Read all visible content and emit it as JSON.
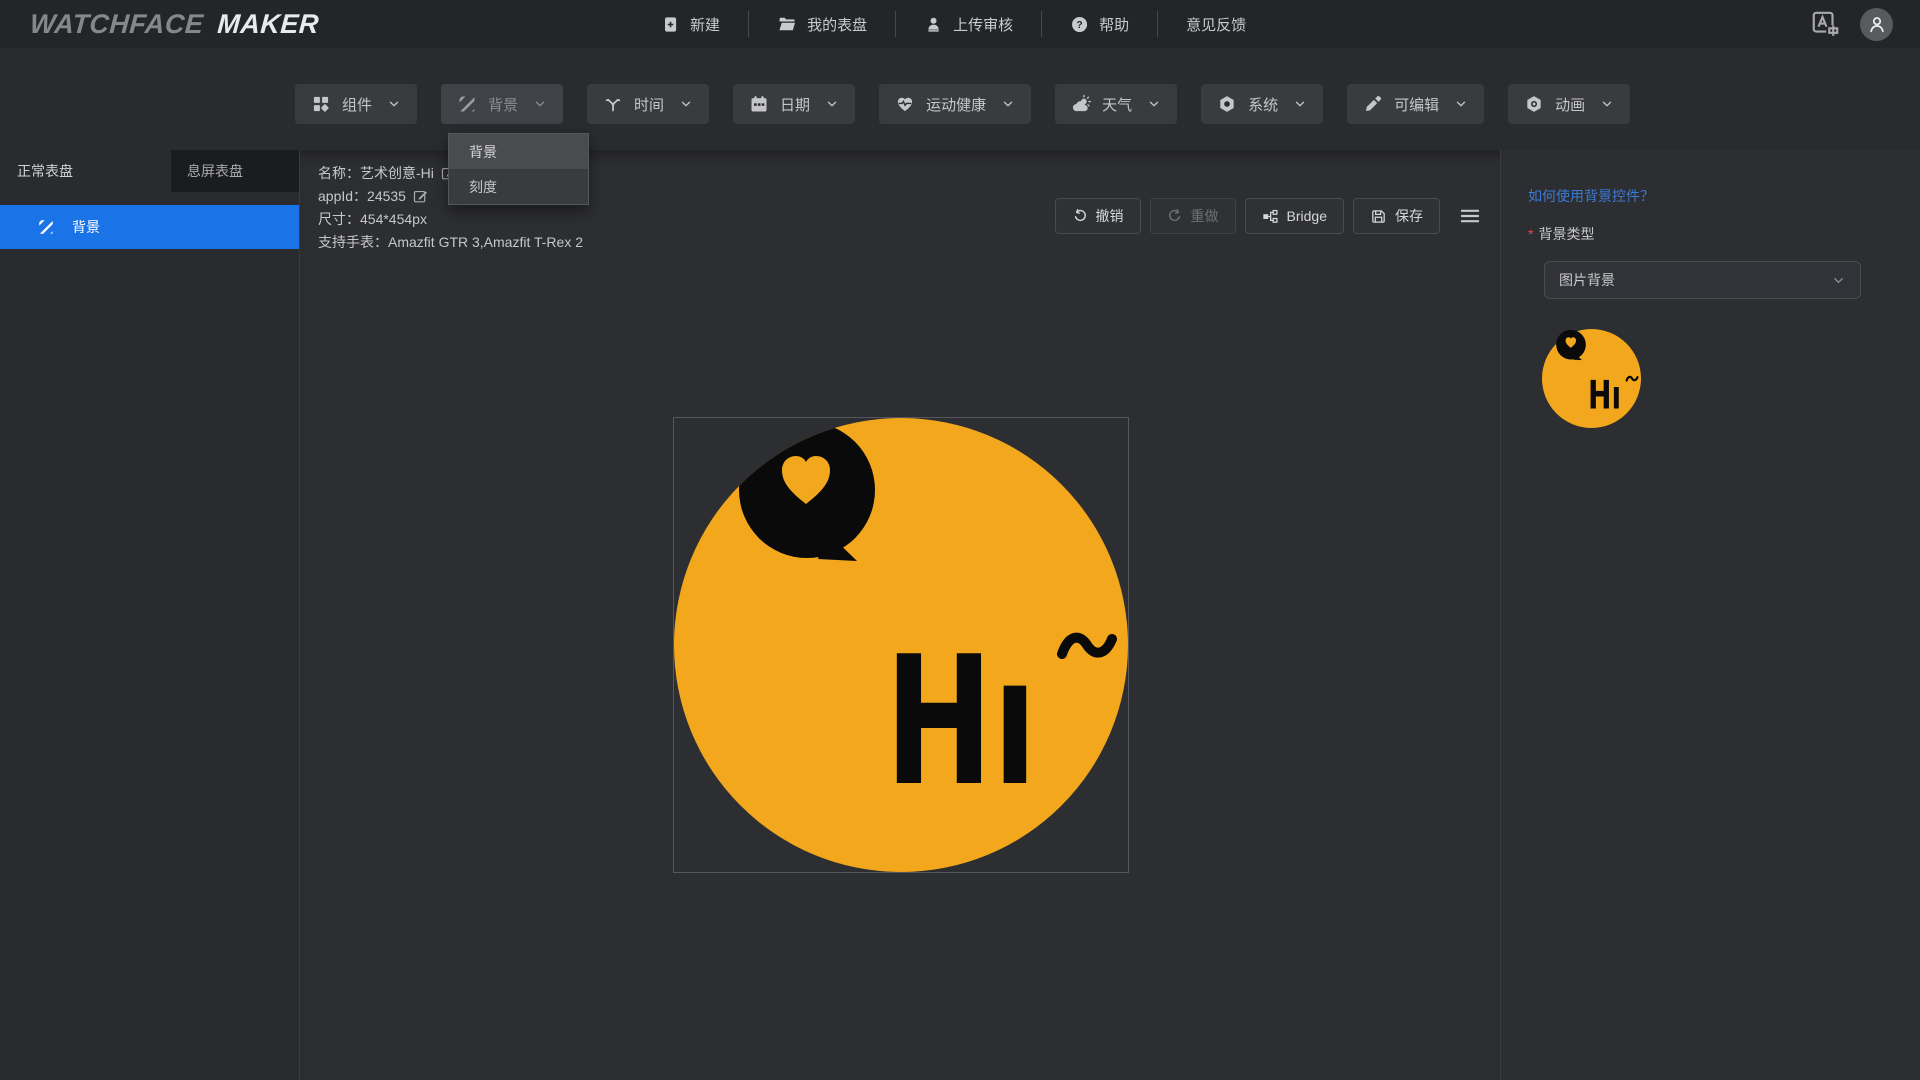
{
  "header": {
    "logo_primary": "WATCHFACE",
    "logo_secondary": "MAKER",
    "nav": [
      "新建",
      "我的表盘",
      "上传审核",
      "帮助",
      "意见反馈"
    ]
  },
  "toolbar": {
    "buttons": [
      {
        "label": "组件"
      },
      {
        "label": "背景",
        "state": "open"
      },
      {
        "label": "时间"
      },
      {
        "label": "日期"
      },
      {
        "label": "运动健康"
      },
      {
        "label": "天气"
      },
      {
        "label": "系统"
      },
      {
        "label": "可编辑"
      },
      {
        "label": "动画"
      }
    ]
  },
  "dropdown": {
    "items": [
      "背景",
      "刻度"
    ],
    "highlighted_index": 0
  },
  "sidebar": {
    "tabs": [
      {
        "label": "正常表盘",
        "active": true
      },
      {
        "label": "息屏表盘",
        "active": false
      }
    ],
    "selected_item": "背景"
  },
  "meta": {
    "name": "名称：艺术创意-Hi",
    "appid": "appId：24535",
    "size": "尺寸：454*454px",
    "watches": "支持手表：Amazfit GTR 3,Amazfit T-Rex 2"
  },
  "actions": {
    "undo": "撤销",
    "redo": "重做",
    "bridge": "Bridge",
    "save": "保存"
  },
  "panel": {
    "help_link": "如何使用背景控件？",
    "bg_type_label": "背景类型",
    "select_value": "图片背景"
  },
  "face": {
    "text": "Hı"
  },
  "colors": {
    "accent_blue": "#1A74E8",
    "link_blue": "#3B7BD6",
    "required_red": "#E04B4B",
    "face_orange": "#F2A71D",
    "face_black": "#0A0A0A"
  }
}
